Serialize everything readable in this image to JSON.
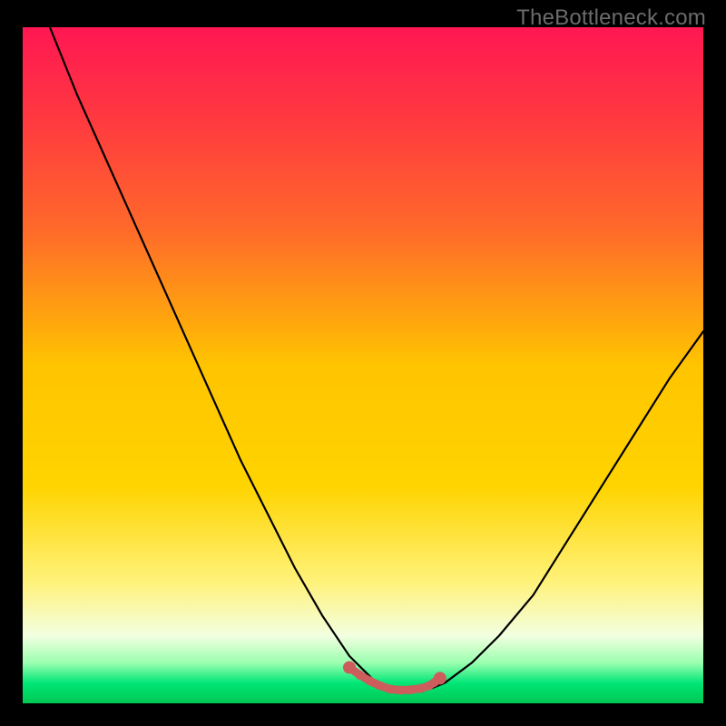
{
  "watermark": "TheBottleneck.com",
  "colors": {
    "bg_black": "#000000",
    "curve": "#000000",
    "marker_fill": "#cd5c5c",
    "marker_stroke": "#cd5c5c",
    "grad_top": "#ff1753",
    "grad_mid_upper": "#ff6a2a",
    "grad_mid": "#ffd400",
    "grad_lower": "#fff27a",
    "grad_pale": "#f3ffe0",
    "grad_green1": "#9bffb0",
    "grad_green2": "#00e676",
    "grad_green3": "#00c853"
  },
  "chart_data": {
    "type": "line",
    "title": "",
    "xlabel": "",
    "ylabel": "",
    "xlim": [
      0,
      100
    ],
    "ylim": [
      0,
      100
    ],
    "curve_x": [
      4,
      8,
      12,
      16,
      20,
      24,
      28,
      32,
      36,
      40,
      44,
      48,
      50,
      52,
      55,
      58,
      60,
      62,
      66,
      70,
      75,
      80,
      85,
      90,
      95,
      100
    ],
    "curve_y": [
      100,
      90,
      81,
      72,
      63,
      54,
      45,
      36,
      28,
      20,
      13,
      7,
      5,
      3,
      2,
      1.9,
      2.2,
      3,
      6,
      10,
      16,
      24,
      32,
      40,
      48,
      55
    ],
    "markers_x": [
      48,
      49.5,
      51,
      52.5,
      54,
      55.5,
      57,
      58.5,
      59.7,
      60.5,
      61.3
    ],
    "markers_y": [
      5.3,
      4.2,
      3.3,
      2.6,
      2.1,
      1.95,
      2.0,
      2.2,
      2.6,
      3.1,
      3.7
    ]
  }
}
